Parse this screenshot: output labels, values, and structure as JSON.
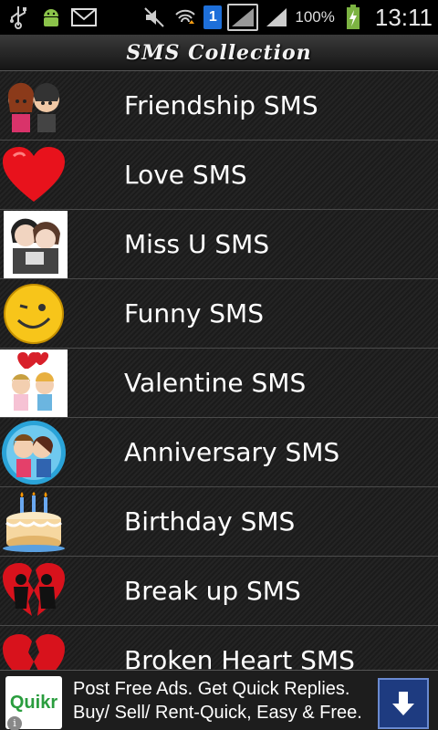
{
  "status_bar": {
    "icons_left": [
      "usb-icon",
      "android-debug-icon",
      "mail-icon"
    ],
    "icons_right": [
      "mute-icon",
      "wifi-transfer-icon",
      "sim-icon",
      "signal-icon",
      "signal-icon",
      "battery-charging-icon"
    ],
    "sim_number": "1",
    "battery": "100%",
    "time": "13:11"
  },
  "header": {
    "title": "SMS Collection"
  },
  "list": {
    "items": [
      {
        "label": "Friendship SMS",
        "icon": "friends-icon"
      },
      {
        "label": "Love SMS",
        "icon": "heart-icon"
      },
      {
        "label": "Miss U SMS",
        "icon": "couple-hug-icon"
      },
      {
        "label": "Funny SMS",
        "icon": "smiley-wink-icon"
      },
      {
        "label": "Valentine SMS",
        "icon": "valentine-couple-icon"
      },
      {
        "label": "Anniversary SMS",
        "icon": "kissing-couple-icon"
      },
      {
        "label": "Birthday SMS",
        "icon": "birthday-cake-icon"
      },
      {
        "label": "Break up SMS",
        "icon": "broken-heart-couple-icon"
      },
      {
        "label": "Broken Heart SMS",
        "icon": "broken-heart-icon"
      }
    ]
  },
  "ad": {
    "logo": "Quikr",
    "line1": "Post Free Ads. Get Quick Replies.",
    "line2": "Buy/ Sell/ Rent-Quick, Easy & Free.",
    "info": "i"
  },
  "colors": {
    "background": "#1d1d1d",
    "row_divider": "#4a4a4a",
    "text": "#ffffff",
    "ad_button": "#1e3b80",
    "logo_green": "#2a9d3e"
  }
}
